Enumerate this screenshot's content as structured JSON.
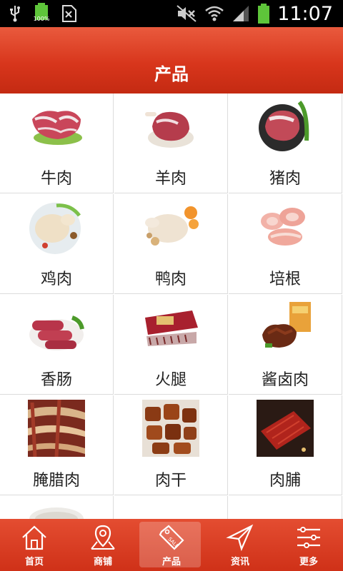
{
  "status_bar": {
    "time": "11:07",
    "battery_small_pct": "100%",
    "icons": [
      "usb-icon",
      "battery-icon",
      "sim-icon",
      "mute-icon",
      "wifi-icon",
      "signal-icon",
      "battery-full-icon"
    ]
  },
  "header": {
    "title": "产品"
  },
  "products": [
    {
      "label": "牛肉",
      "image": "beef-image"
    },
    {
      "label": "羊肉",
      "image": "lamb-image"
    },
    {
      "label": "猪肉",
      "image": "pork-image"
    },
    {
      "label": "鸡肉",
      "image": "chicken-image"
    },
    {
      "label": "鸭肉",
      "image": "duck-image"
    },
    {
      "label": "培根",
      "image": "bacon-image"
    },
    {
      "label": "香肠",
      "image": "sausage-image"
    },
    {
      "label": "火腿",
      "image": "ham-image"
    },
    {
      "label": "酱卤肉",
      "image": "braised-meat-image"
    },
    {
      "label": "腌腊肉",
      "image": "cured-meat-image"
    },
    {
      "label": "肉干",
      "image": "jerky-image"
    },
    {
      "label": "肉脯",
      "image": "meat-slice-image"
    },
    {
      "label": "",
      "image": "partial-item-image"
    },
    {
      "label": "",
      "image": "empty"
    },
    {
      "label": "",
      "image": "empty"
    }
  ],
  "bottom_nav": [
    {
      "label": "首页",
      "icon": "home-icon",
      "active": false
    },
    {
      "label": "商铺",
      "icon": "map-pin-icon",
      "active": false
    },
    {
      "label": "产品",
      "icon": "sale-tag-icon",
      "active": true
    },
    {
      "label": "资讯",
      "icon": "send-icon",
      "active": false
    },
    {
      "label": "更多",
      "icon": "sliders-icon",
      "active": false
    }
  ],
  "colors": {
    "header": "#d8361c",
    "nav": "#d33419",
    "text": "#222222",
    "divider": "#dcdcdc"
  }
}
